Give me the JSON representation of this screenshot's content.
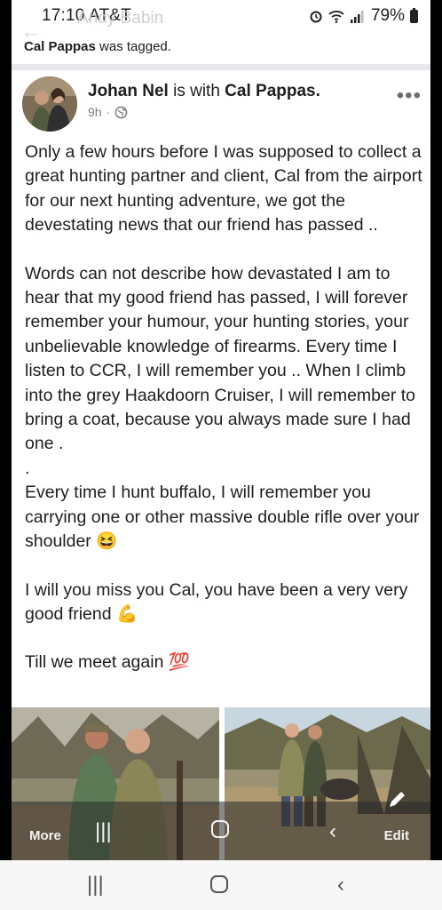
{
  "status_bar": {
    "time": "17:10",
    "carrier": "AT&T",
    "ghost_name": "Andy Babin",
    "battery": "79%",
    "icons": [
      "alarm-icon",
      "wifi-icon",
      "signal-icon",
      "battery-icon"
    ]
  },
  "tag_notice": {
    "name": "Cal Pappas",
    "text": " was tagged."
  },
  "post": {
    "author": "Johan Nel",
    "with_text": " is with ",
    "tagged_name": "Cal Pappas.",
    "time": "9h",
    "separator": "·",
    "audience_icon": "globe-icon",
    "paragraphs": [
      "Only a few hours before I was supposed to collect a great hunting partner and client, Cal from the airport for our next hunting adventure, we got the devestating news that our friend has passed ..",
      "Words can not describe how devastated I am to hear that my good friend has passed, I will forever remember your humour, your hunting stories, your unbelievable knowledge of firearms. Every time I listen to CCR, I will remember you .. When I climb into the grey Haakdoorn Cruiser, I will remember to bring a coat, because you always made sure I had one .\n.",
      "Every time I hunt buffalo, I will remember you carrying one or other massive double rifle over your shoulder",
      "I will you miss you Cal, you have been a very very good friend",
      "Till we meet again"
    ],
    "emojis": {
      "laugh": "😆",
      "strong": "💪",
      "hundred": "💯"
    }
  },
  "overlay_toolbar": {
    "more_label": "More",
    "edit_label": "Edit"
  },
  "colors": {
    "frame": "#000000",
    "text": "#1c1e21",
    "meta": "#7a7d82",
    "divider": "#e6e7eb"
  }
}
